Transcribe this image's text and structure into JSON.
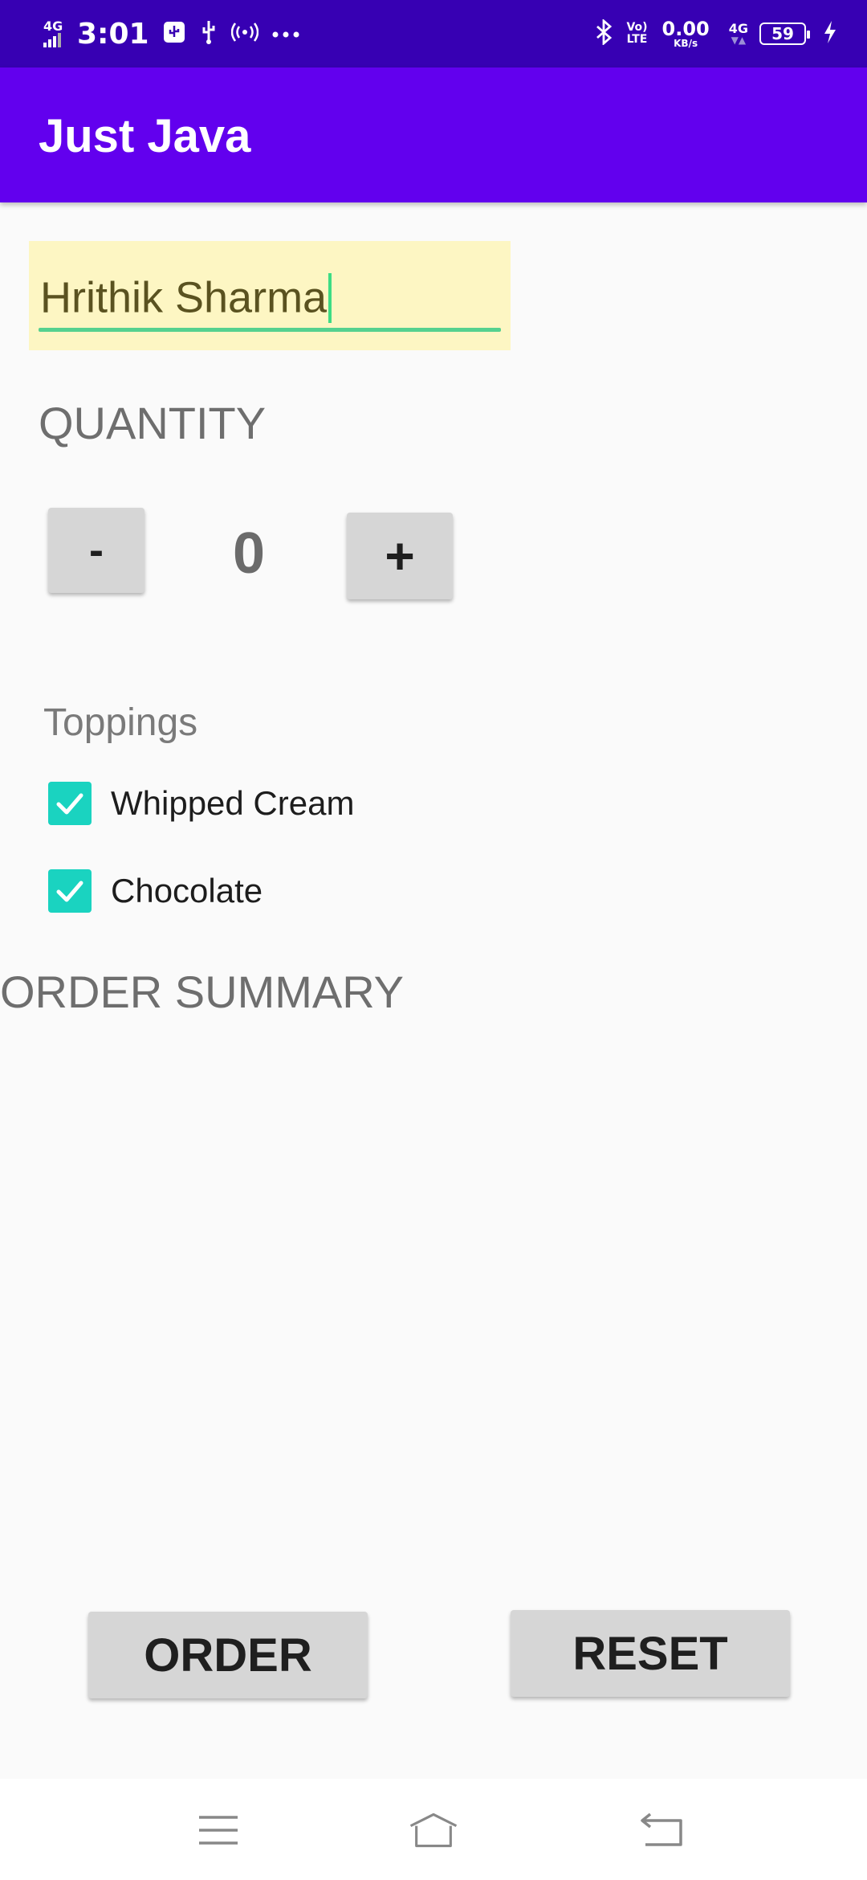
{
  "status_bar": {
    "time": "3:01",
    "network_left": "4G",
    "volte": "Vo) LTE",
    "speed": "0.00",
    "speed_unit": "KB/s",
    "network_right": "4G",
    "battery": "59",
    "icons": [
      "signal-icon",
      "usb-icon",
      "hotspot-icon",
      "more-dots-icon",
      "bluetooth-icon",
      "charging-icon"
    ]
  },
  "app_bar": {
    "title": "Just Java"
  },
  "name_field": {
    "value": "Hrithik Sharma"
  },
  "quantity": {
    "title": "QUANTITY",
    "minus_label": "-",
    "value": "0",
    "plus_label": "+"
  },
  "toppings": {
    "title": "Toppings",
    "items": [
      {
        "label": "Whipped Cream",
        "checked": true
      },
      {
        "label": "Chocolate",
        "checked": true
      }
    ]
  },
  "order_summary": {
    "title": "ORDER SUMMARY"
  },
  "actions": {
    "order_label": "ORDER",
    "reset_label": "RESET"
  },
  "colors": {
    "status_bar": "#3700b3",
    "app_bar": "#6200ee",
    "accent": "#1ad3c0",
    "field_highlight": "#fdf6c3"
  },
  "nav_bar": {
    "icons": [
      "menu-icon",
      "home-icon",
      "back-icon"
    ]
  }
}
